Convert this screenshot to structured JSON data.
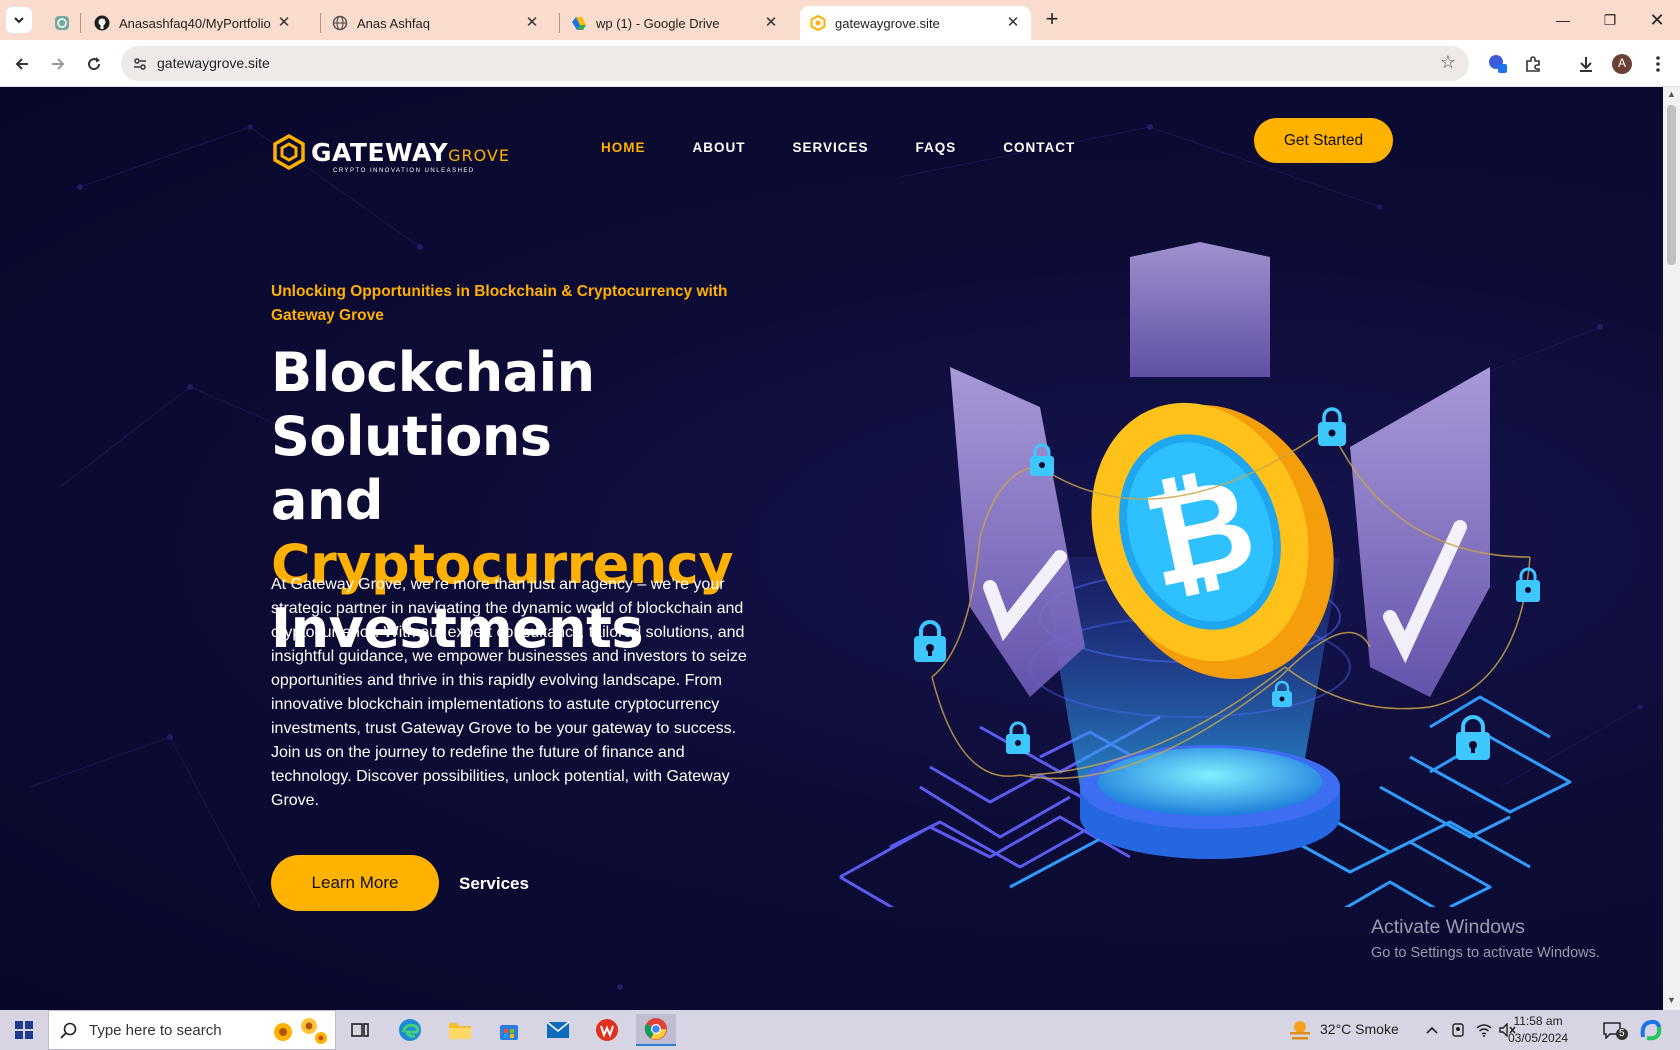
{
  "browser": {
    "tabs": [
      {
        "title": "",
        "icon": "chatgpt-icon"
      },
      {
        "title": "Anasashfaq40/MyPortfolio",
        "icon": "github-icon"
      },
      {
        "title": "Anas Ashfaq",
        "icon": "globe-icon"
      },
      {
        "title": "wp (1) - Google Drive",
        "icon": "google-drive-icon"
      },
      {
        "title": "gatewaygrove.site",
        "icon": "gatewaygrove-icon",
        "active": true
      }
    ],
    "url": "gatewaygrove.site",
    "profile_initial": "A"
  },
  "site": {
    "logo": {
      "main": "GATEWAY",
      "accent": "GROVE",
      "tagline": "CRYPTO INNOVATION UNLEASHED"
    },
    "nav": [
      {
        "label": "HOME",
        "active": true
      },
      {
        "label": "ABOUT"
      },
      {
        "label": "SERVICES"
      },
      {
        "label": "FAQS"
      },
      {
        "label": "CONTACT"
      }
    ],
    "cta": "Get Started",
    "hero": {
      "eyebrow": "Unlocking Opportunities in Blockchain & Cryptocurrency with Gateway Grove",
      "title_line1": "Blockchain Solutions",
      "title_and": "and ",
      "title_highlight": "Cryptocurrency",
      "title_line3": "Investments",
      "description": "At Gateway Grove, we’re more than just an agency – we’re your strategic partner in navigating the dynamic world of blockchain and cryptocurrency. With our expert consultancy, tailored solutions, and insightful guidance, we empower businesses and investors to seize opportunities and thrive in this rapidly evolving landscape. From innovative blockchain implementations to astute cryptocurrency investments, trust Gateway Grove to be your gateway to success. Join us on the journey to redefine the future of finance and technology. Discover possibilities, unlock potential, with Gateway Grove.",
      "primary_button": "Learn More",
      "secondary_link": "Services"
    },
    "colors": {
      "accent": "#ffb000",
      "background": "#0b0a2a"
    }
  },
  "watermark": {
    "line1": "Activate Windows",
    "line2": "Go to Settings to activate Windows."
  },
  "taskbar": {
    "search_placeholder": "Type here to search",
    "weather": "32°C  Smoke",
    "time": "11:58 am",
    "date": "03/05/2024",
    "notifications": "5"
  }
}
